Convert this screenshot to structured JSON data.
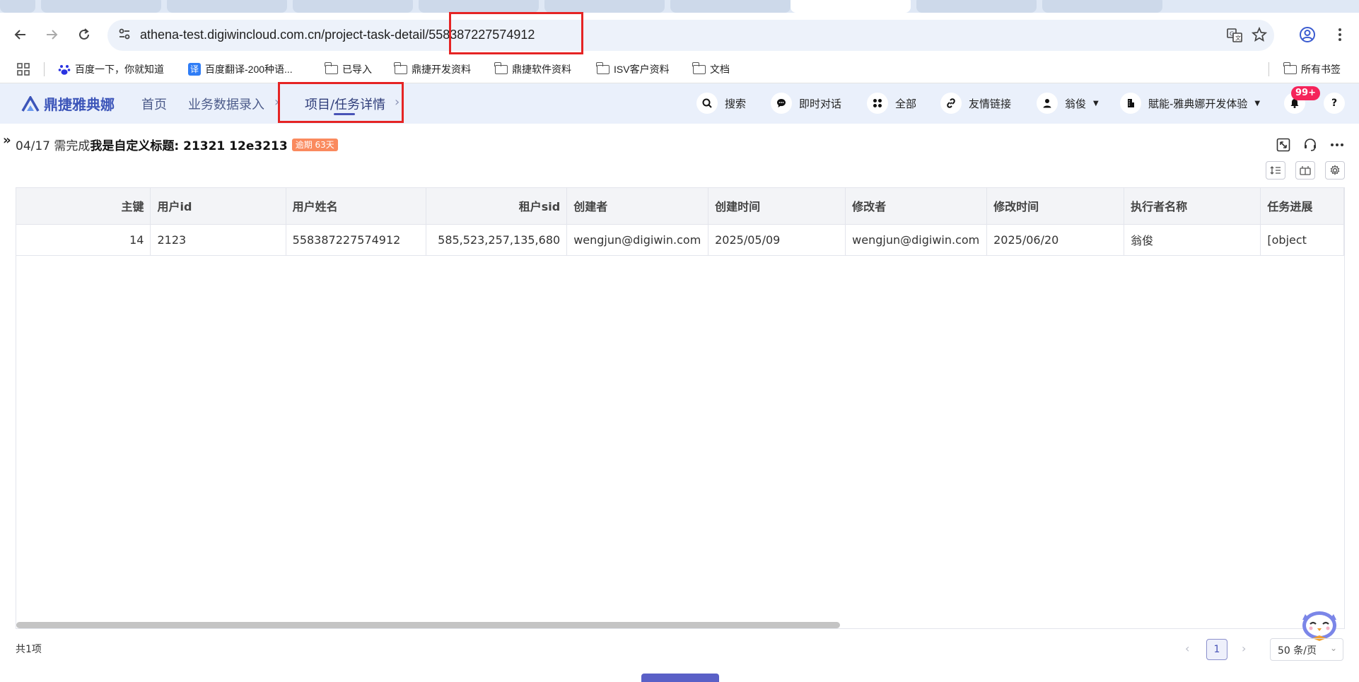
{
  "browser": {
    "url_host": "athena-test.digiwincloud.com.cn/project-task-detail/",
    "url_id": "558387227574912",
    "bookmarks": [
      {
        "label": "百度一下，你就知道",
        "icon": "baidu-paw-icon"
      },
      {
        "label": "百度翻译-200种语...",
        "icon": "translate-icon"
      },
      {
        "label": "已导入",
        "icon": "folder-icon"
      },
      {
        "label": "鼎捷开发资料",
        "icon": "folder-icon"
      },
      {
        "label": "鼎捷软件资料",
        "icon": "folder-icon"
      },
      {
        "label": "ISV客户资料",
        "icon": "folder-icon"
      },
      {
        "label": "文档",
        "icon": "folder-icon"
      }
    ],
    "all_bookmarks": "所有书签"
  },
  "app": {
    "logo": "鼎捷雅典娜",
    "nav": [
      {
        "label": "首页"
      },
      {
        "label": "业务数据录入"
      },
      {
        "label": "项目/任务详情"
      }
    ],
    "header_items": {
      "search": "搜索",
      "chat": "即时对话",
      "all": "全部",
      "links": "友情链接",
      "user": "翁俊",
      "tenant": "賦能-雅典娜开发体验"
    },
    "notification_count": "99+",
    "help": "?"
  },
  "task": {
    "date": "04/17 需完成",
    "title": "我是自定义标题: 21321 12e3213",
    "overdue": "逾期 63天"
  },
  "table": {
    "headers": [
      "主键",
      "用户id",
      "用户姓名",
      "租户sid",
      "创建者",
      "创建时间",
      "修改者",
      "修改时间",
      "执行者名称",
      "任务进展"
    ],
    "rows": [
      [
        "14",
        "2123",
        "558387227574912",
        "585,523,257,135,680",
        "wengjun@digiwin.com",
        "2025/05/09",
        "wengjun@digiwin.com",
        "2025/06/20",
        "翁俊",
        "[object"
      ]
    ]
  },
  "pagination": {
    "total": "共1项",
    "prev": "‹",
    "current": "1",
    "next": "›",
    "page_size": "50 条/页"
  },
  "colors": {
    "accent": "#4853b7",
    "highlight_box": "#e52424",
    "header_bg": "#eaf0fb",
    "overdue_badge": "#fa8a5e",
    "notification_badge": "#f5245a"
  }
}
